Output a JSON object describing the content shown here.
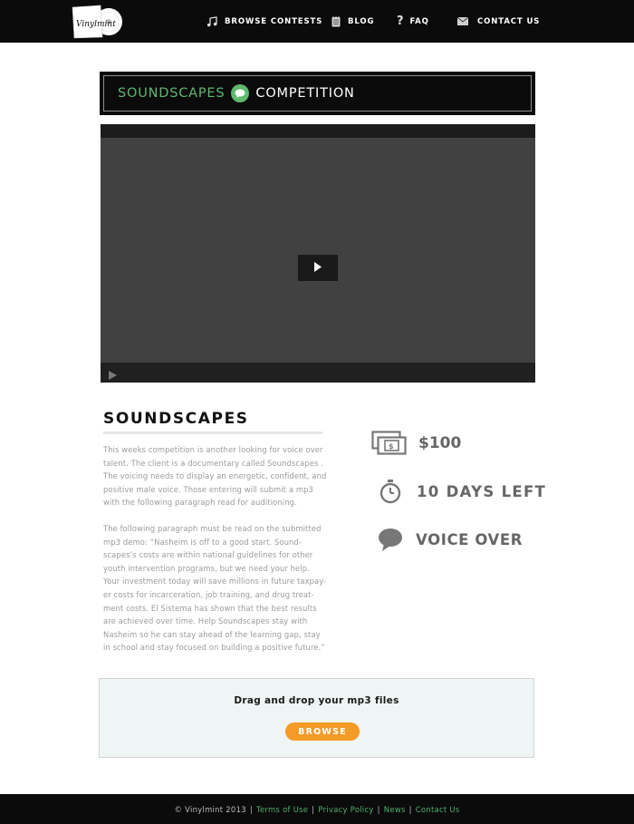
{
  "brand": {
    "logo_text": "Vinylmint"
  },
  "nav": {
    "items": [
      {
        "label": "BROWSE CONTESTS",
        "icon": "music-note-icon"
      },
      {
        "label": "BLOG",
        "icon": "notebook-icon"
      },
      {
        "label": "FAQ",
        "icon": "question-mark-icon"
      },
      {
        "label": "CONTACT US",
        "icon": "envelope-icon"
      }
    ]
  },
  "banner": {
    "word1": "SOUNDSCAPES",
    "word2": "COMPETITION"
  },
  "video": {
    "play_icon": "play-icon"
  },
  "contest": {
    "title": "SOUNDSCAPES",
    "paragraph1": "This weeks competition is another looking for voice over\ntalent. The client is a documentary called Soundscapes .\nThe voicing needs to display an energetic, confident, and\npositive male voice. Those entering will submit a mp3\nwith the following paragraph read for auditioning.",
    "paragraph2": "The following paragraph must be read on the submitted\nmp3 demo: “Nasheim is off to a good start. Sound-\nscapes’s costs are within national guidelines for other\nyouth intervention programs, but we need your help.\nYour investment today will save millions in future taxpay-\ner costs for incarceration, job training, and drug treat-\nment costs. El Sistema has shown that the best results\nare achieved over time. Help Soundscapes stay with\nNasheim so he can stay ahead of the learning gap, stay\nin school and stay focused on building a positive future.”"
  },
  "stats": {
    "prize": "$100",
    "days_left": "10 DAYS LEFT",
    "category": "VOICE OVER"
  },
  "upload": {
    "label": "Drag and drop your mp3 files",
    "button": "BROWSE"
  },
  "footer": {
    "copyright": "© Vinylmint 2013",
    "links": [
      "Terms of Use",
      "Privacy Policy",
      "News",
      "Contact Us"
    ]
  },
  "colors": {
    "accent_green": "#5fba6d",
    "browse_orange": "#f39a27",
    "header_black": "#0b0b0c"
  }
}
